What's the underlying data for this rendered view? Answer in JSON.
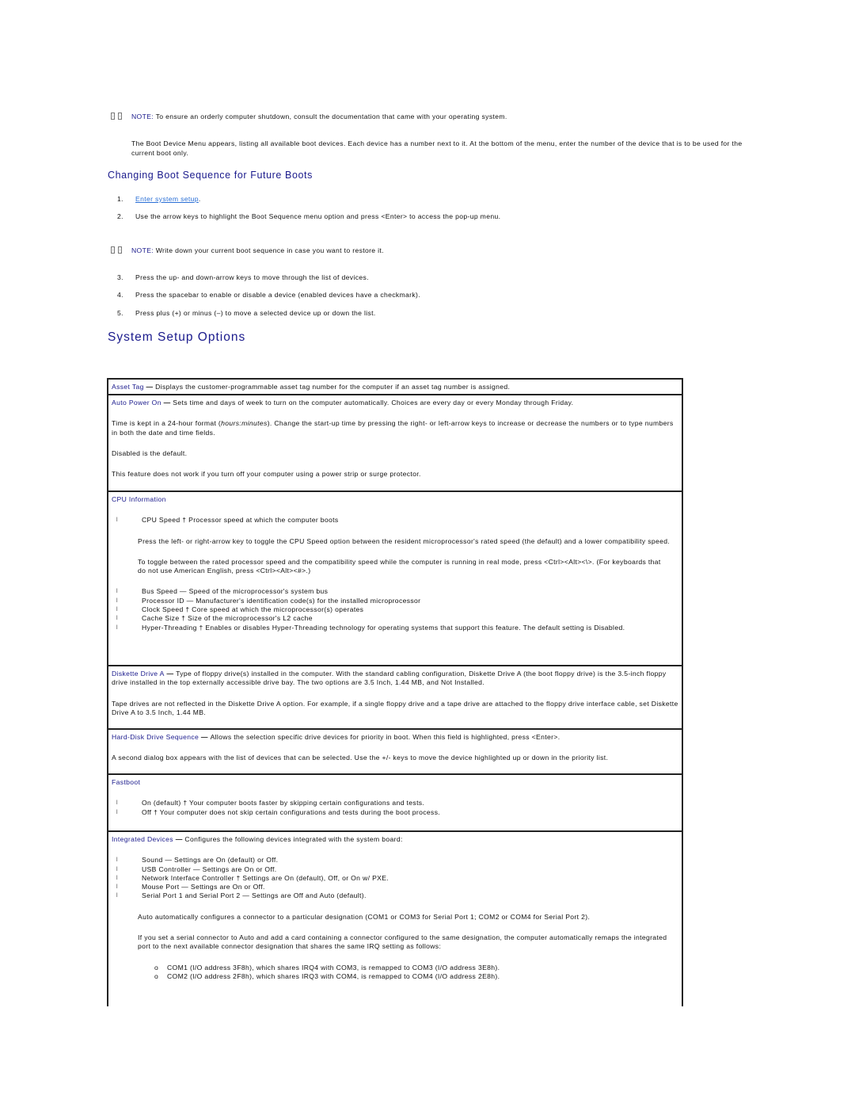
{
  "notes": [
    {
      "label": "NOTE:",
      "text": " To ensure an orderly computer shutdown, consult the documentation that came with your operating system."
    },
    {
      "label": "NOTE:",
      "text": " Write down your current boot sequence in case you want to restore it."
    }
  ],
  "boot_device_para": "The Boot Device Menu appears, listing all available boot devices. Each device has a number next to it. At the bottom of the menu, enter the number of the device that is to be used for the current boot only.",
  "subheading": "Changing Boot Sequence for Future Boots",
  "steps": [
    {
      "num": "1.",
      "link": "Enter system setup",
      "text": "."
    },
    {
      "num": "2.",
      "text": "Use the arrow keys to highlight the Boot Sequence menu option and press <Enter> to access the pop-up menu."
    },
    {
      "num": "3.",
      "text": "Press the up- and down-arrow keys to move through the list of devices."
    },
    {
      "num": "4.",
      "text": "Press the spacebar to enable or disable a device (enabled devices have a checkmark)."
    },
    {
      "num": "5.",
      "text": "Press plus (+) or minus (–) to move a selected device up or down the list."
    }
  ],
  "section_title": "System Setup Options",
  "options": {
    "asset_tag": {
      "name": "Asset Tag",
      "dash": " — ",
      "text": "Displays the customer-programmable asset tag number for the computer if an asset tag number is assigned."
    },
    "auto_power_on": {
      "name": "Auto Power On",
      "dash": " — ",
      "text": "Sets time and days of week to turn on the computer automatically. Choices are every day or every Monday through Friday.",
      "p2_before": "Time is kept in a 24-hour format (",
      "p2_italic": "hours:minutes",
      "p2_after": "). Change the start-up time by pressing the right- or left-arrow keys to increase or decrease the numbers or to type numbers in both the date and time fields.",
      "p3": "Disabled is the default.",
      "p4": "This feature does not work if you turn off your computer using a power strip or surge protector."
    },
    "cpu_info": {
      "name": "CPU Information",
      "bullet_glyph": "l",
      "cpu_speed": "CPU Speed † Processor speed at which the computer boots",
      "p1": "Press the left- or right-arrow key to toggle the CPU Speed option between the resident microprocessor's rated speed (the default) and a lower compatibility speed.",
      "p2": "To toggle between the rated processor speed and the compatibility speed while the computer is running in real mode, press <Ctrl><Alt><\\>. (For keyboards that do not use American English, press <Ctrl><Alt><#>.)",
      "items": [
        "Bus Speed — Speed of the microprocessor's system bus",
        "Processor ID — Manufacturer's identification code(s) for the installed microprocessor",
        "Clock Speed † Core speed at which the microprocessor(s) operates",
        "Cache Size † Size of the microprocessor's L2 cache",
        "Hyper-Threading † Enables or disables Hyper-Threading technology for operating systems that support this feature. The default setting is Disabled."
      ]
    },
    "diskette_drive": {
      "name": "Diskette Drive A",
      "dash": " — ",
      "text": "Type of floppy drive(s) installed in the computer. With the standard cabling configuration, Diskette Drive A (the boot floppy drive) is the 3.5-inch floppy drive installed in the top externally accessible drive bay. The two options are 3.5 Inch, 1.44 MB, and Not Installed.",
      "p2": "Tape drives are not reflected in the Diskette Drive A option. For example, if a single floppy drive and a tape drive are attached to the floppy drive interface cable, set Diskette Drive A to 3.5 Inch, 1.44 MB."
    },
    "hdd_sequence": {
      "name": "Hard-Disk Drive Sequence",
      "dash": " — ",
      "text": "Allows the selection specific drive devices for priority in boot. When this field is highlighted, press <Enter>.",
      "p2": "A second dialog box appears with the list of devices that can be selected. Use the +/- keys to move the device highlighted up or down in the priority list."
    },
    "fastboot": {
      "name": "Fastboot",
      "items": [
        "On (default) † Your computer boots faster by skipping certain configurations and tests.",
        "Off † Your computer does not skip certain configurations and tests during the boot process."
      ]
    },
    "integrated_devices": {
      "name": "Integrated Devices",
      "dash": " — ",
      "text": "Configures the following devices integrated with the system board:",
      "items": [
        "Sound — Settings are On (default) or Off.",
        "USB Controller — Settings are On or Off.",
        "Network Interface Controller † Settings are On (default), Off, or On w/ PXE.",
        "Mouse Port — Settings are On or Off.",
        "Serial Port 1 and Serial Port 2 — Settings are Off and Auto (default)."
      ],
      "p_auto": "Auto automatically configures a connector to a particular designation (COM1 or COM3 for Serial Port 1; COM2 or COM4 for Serial Port 2).",
      "p_remap": "If you set a serial connector to Auto and add a card containing a connector configured to the same designation, the computer automatically remaps the integrated port to the next available connector designation that shares the same IRQ setting as follows:",
      "sub_glyph": "o",
      "sub_items": [
        "COM1 (I/O address 3F8h), which shares IRQ4 with COM3, is remapped to COM3 (I/O address 3E8h).",
        "COM2 (I/O address 2F8h), which shares IRQ3 with COM4, is remapped to COM4 (I/O address 2E8h)."
      ]
    }
  }
}
